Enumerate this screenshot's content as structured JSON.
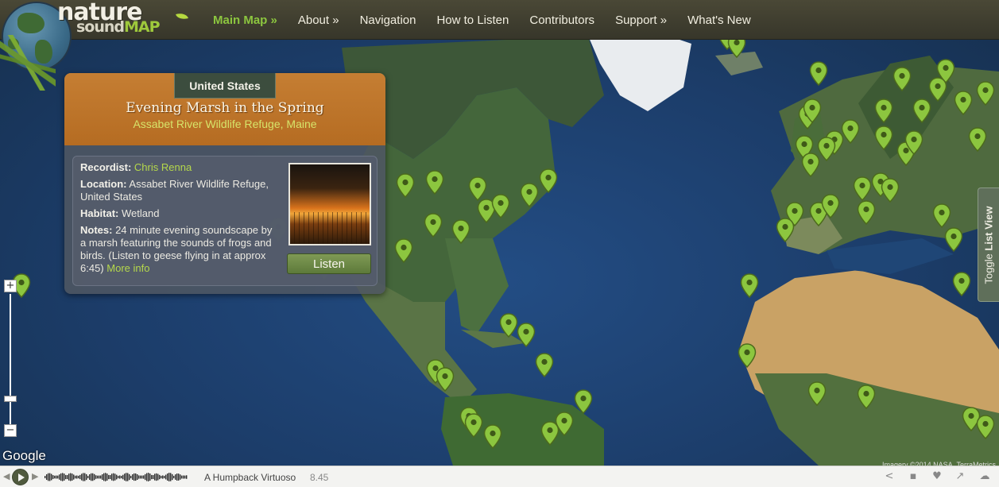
{
  "logo": {
    "word1": "nature",
    "word2_prefix": "sound",
    "word2_suffix": "MAP"
  },
  "nav": [
    {
      "label": "Main Map »",
      "active": true
    },
    {
      "label": "About »",
      "active": false
    },
    {
      "label": "Navigation",
      "active": false
    },
    {
      "label": "How to Listen",
      "active": false
    },
    {
      "label": "Contributors",
      "active": false
    },
    {
      "label": "Support »",
      "active": false
    },
    {
      "label": "What's New",
      "active": false
    }
  ],
  "card": {
    "country": "United States",
    "title": "Evening Marsh in the Spring",
    "subtitle": "Assabet River Wildlife Refuge, Maine",
    "recordist_label": "Recordist:",
    "recordist": "Chris Renna",
    "location_label": "Location:",
    "location": "Assabet River Wildlife Refuge, United States",
    "habitat_label": "Habitat:",
    "habitat": "Wetland",
    "notes_label": "Notes:",
    "notes": "24 minute evening soundscape by a marsh featuring the sounds of frogs and birds. (Listen to geese flying in at approx 6:45)",
    "more_info": "More info",
    "listen_button": "Listen"
  },
  "map": {
    "google_logo": "Google",
    "zoom_in": "+",
    "zoom_out": "−",
    "zoom_mid": "−",
    "attribution": "Imagery ©2014 NASA, TerraMetrics",
    "toggle_list_prefix": "Toggle ",
    "toggle_list_bold": "List View",
    "pin_color": "#8cc63f"
  },
  "player": {
    "track_title": "A Humpback Virtuoso",
    "duration": "8.45",
    "prev_icon": "◀",
    "next_icon": "▶",
    "share_icon": "share-icon",
    "comment_icon": "comment-icon",
    "like_icon": "heart-icon",
    "popout_icon": "external-link-icon",
    "soundcloud_icon": "soundcloud-icon"
  }
}
